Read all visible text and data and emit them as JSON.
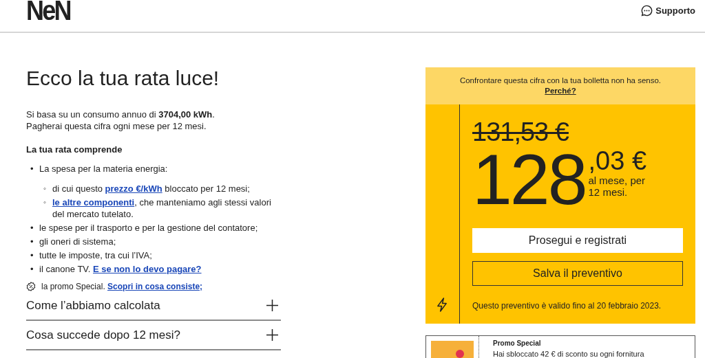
{
  "header": {
    "logo": "NeN",
    "support": "Supporto"
  },
  "title": "Ecco la tua rata luce!",
  "intro": [
    "Si basa su un consumo annuo di **3704,00 kWh**.",
    "Pagherai questa cifra ogni mese per 12 mesi."
  ],
  "includes_heading": "La tua rata comprende",
  "includes": [
    {
      "marker": "•",
      "parts": [
        {
          "text": "La spesa per la materia energia:"
        }
      ],
      "children": [
        {
          "marker": "◦",
          "parts": [
            {
              "text": "di cui questo "
            },
            {
              "link": "prezzo €/kWh"
            },
            {
              "text": " bloccato per 12 mesi;"
            }
          ]
        },
        {
          "marker": "◦",
          "parts": [
            {
              "link": "le altre componenti"
            },
            {
              "text": ", che manteniamo agli stessi valori del mercato tutelato."
            }
          ]
        }
      ]
    },
    {
      "marker": "•",
      "parts": [
        {
          "text": "le spese per il trasporto e per la gestione del contatore;"
        }
      ]
    },
    {
      "marker": "•",
      "parts": [
        {
          "text": "gli oneri di sistema;"
        }
      ]
    },
    {
      "marker": "•",
      "parts": [
        {
          "text": "tutte le imposte, tra cui l’IVA;"
        }
      ]
    },
    {
      "marker": "•",
      "parts": [
        {
          "text": "il canone TV. "
        },
        {
          "link": "E se non lo devo pagare?"
        }
      ]
    }
  ],
  "promo_line": {
    "text": "la promo Special. ",
    "link": "Scopri in cosa consiste;"
  },
  "accordions": [
    {
      "label": "Come l’abbiamo calcolata",
      "expanded": false
    },
    {
      "label": "Cosa succede dopo 12 mesi?",
      "expanded": false
    }
  ],
  "price_card": {
    "notice": "Confrontare questa cifra con la tua bolletta non ha senso.",
    "notice_link": "Perché?",
    "old_price": "131,53 €",
    "price_whole": "128",
    "price_cents": ",03 €",
    "period": "al mese, per 12 mesi.",
    "primary_button": "Prosegui e registrati",
    "secondary_button": "Salva il preventivo",
    "validity": "Questo preventivo è valido fino al 20 febbraio 2023."
  },
  "promo_card": {
    "title": "Promo Special",
    "text": "Hai sbloccato 42 € di sconto su ogni fornitura"
  }
}
